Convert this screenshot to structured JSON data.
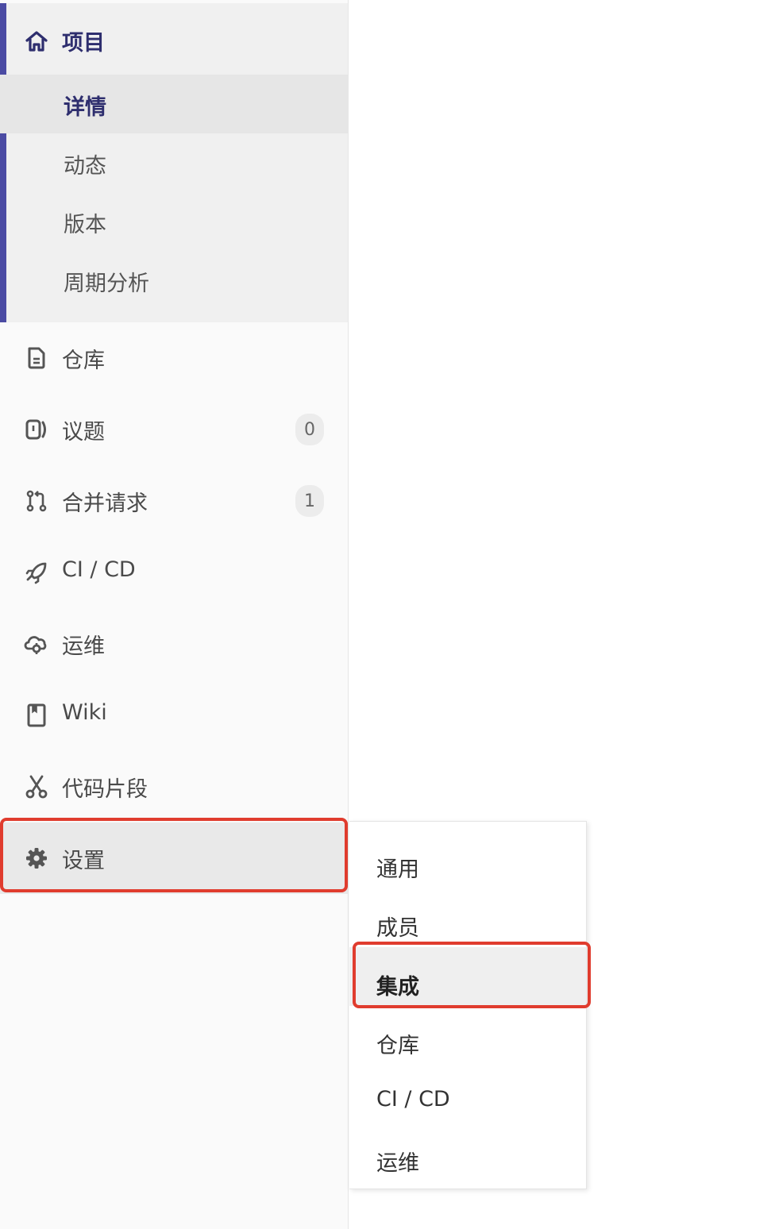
{
  "sidebar": {
    "project": {
      "label": "项目",
      "icon": "home-icon",
      "subitems": [
        {
          "label": "详情",
          "active": true
        },
        {
          "label": "动态"
        },
        {
          "label": "版本"
        },
        {
          "label": "周期分析"
        }
      ]
    },
    "items": [
      {
        "label": "仓库",
        "icon": "file-icon"
      },
      {
        "label": "议题",
        "icon": "issues-icon",
        "badge": "0"
      },
      {
        "label": "合并请求",
        "icon": "merge-request-icon",
        "badge": "1"
      },
      {
        "label": "CI / CD",
        "icon": "rocket-icon"
      },
      {
        "label": "运维",
        "icon": "cloud-gear-icon"
      },
      {
        "label": "Wiki",
        "icon": "book-icon"
      },
      {
        "label": "代码片段",
        "icon": "scissors-icon"
      },
      {
        "label": "设置",
        "icon": "gear-icon",
        "highlighted": true
      }
    ]
  },
  "settings_flyout": {
    "items": [
      {
        "label": "通用"
      },
      {
        "label": "成员"
      },
      {
        "label": "集成",
        "active": true,
        "highlighted": true
      },
      {
        "label": "仓库"
      },
      {
        "label": "CI / CD"
      },
      {
        "label": "运维"
      }
    ]
  },
  "colors": {
    "accent": "#4b4ba3",
    "highlight": "#e03c2e",
    "active_bg": "#e6e6e6"
  }
}
